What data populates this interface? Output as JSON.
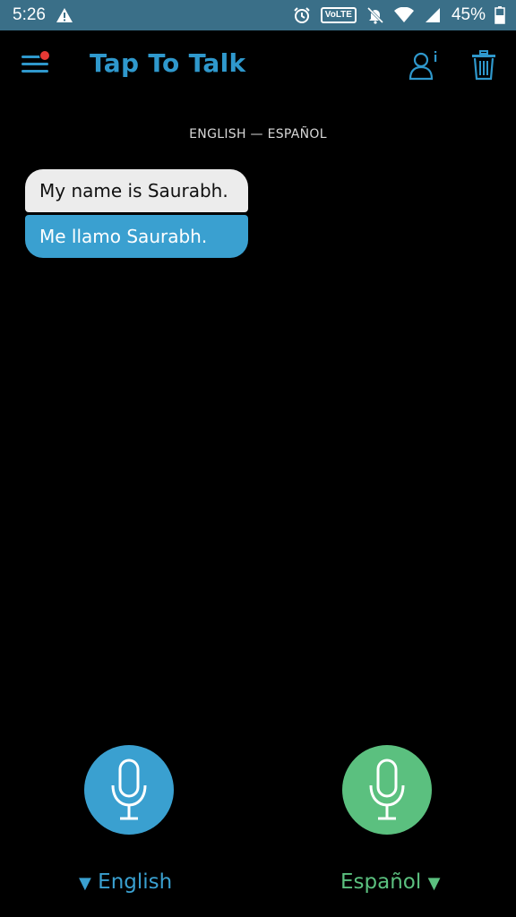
{
  "status_bar": {
    "time": "5:26",
    "volte_label": "VoLTE",
    "battery_percent": "45%",
    "icons": [
      "warning-icon",
      "alarm-icon",
      "volte-icon",
      "mute-icon",
      "wifi-icon",
      "signal-icon",
      "battery-icon"
    ]
  },
  "app_bar": {
    "title": "Tap To Talk",
    "menu_has_notification": true,
    "actions": [
      "user-info-icon",
      "trash-icon"
    ]
  },
  "conversation": {
    "language_pair": "ENGLISH — ESPAÑOL",
    "messages": [
      {
        "source": "My name is Saurabh.",
        "translation": "Me llamo Saurabh."
      }
    ]
  },
  "controls": {
    "left_language": "English",
    "right_language": "Español",
    "left_color": "#3aa0d0",
    "right_color": "#5bc07f"
  },
  "colors": {
    "accent": "#2f98cc",
    "status_bar": "#3a6f88",
    "background": "#000000"
  }
}
